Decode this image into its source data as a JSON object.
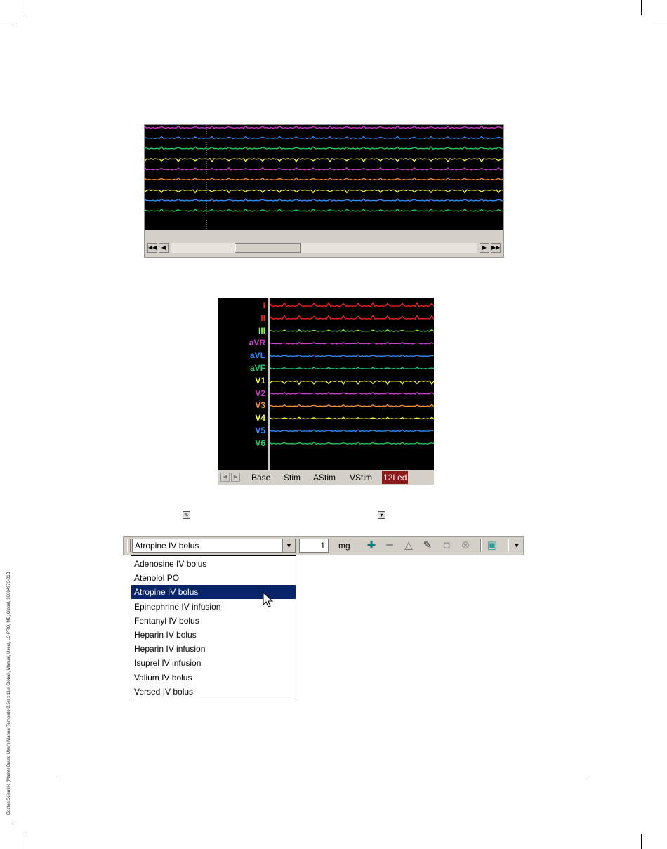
{
  "margin_note": "Boston Scientific (Master Brand User's Manual Template 8.5in x 11in Global), Manual, Users, LS PRO, MB, Global, 90084973-01B",
  "strip_panel": {
    "trace_colors": [
      "#d040d0",
      "#3090ff",
      "#20d060",
      "#ffff40",
      "#d040d0",
      "#ff9030",
      "#ffff40",
      "#3090ff",
      "#20d060"
    ],
    "scroll_buttons": {
      "first": "◀◀",
      "prev": "◀",
      "next": "▶",
      "last": "▶▶"
    }
  },
  "lead_panel": {
    "leads": [
      {
        "name": "I",
        "color": "#ff2020"
      },
      {
        "name": "II",
        "color": "#ff2020"
      },
      {
        "name": "III",
        "color": "#80ff40"
      },
      {
        "name": "aVR",
        "color": "#d040d0"
      },
      {
        "name": "aVL",
        "color": "#3090ff"
      },
      {
        "name": "aVF",
        "color": "#20d080"
      },
      {
        "name": "V1",
        "color": "#ffff40"
      },
      {
        "name": "V2",
        "color": "#d040d0"
      },
      {
        "name": "V3",
        "color": "#ff9030"
      },
      {
        "name": "V4",
        "color": "#ffff40"
      },
      {
        "name": "V5",
        "color": "#3090ff"
      },
      {
        "name": "V6",
        "color": "#20d060"
      }
    ],
    "tabs": [
      "Base",
      "Stim",
      "AStim",
      "VStim",
      "12Led"
    ],
    "active_tab": "12Led",
    "tab_arrows": {
      "left": "◀",
      "right": "▶"
    }
  },
  "inline_icons": {
    "pen": "✎",
    "syringe_pump": "▾"
  },
  "drug_toolbar": {
    "selected_drug": "Atropine IV bolus",
    "dropdown_arrow": "▼",
    "dose_value": "1",
    "dose_unit": "mg",
    "icons": [
      {
        "name": "add-icon",
        "glyph": "✚",
        "color": "#007a7a"
      },
      {
        "name": "remove-icon",
        "glyph": "━",
        "color": "#8a8a8a"
      },
      {
        "name": "triangle-icon",
        "glyph": "△",
        "color": "#707070"
      },
      {
        "name": "syringe-icon",
        "glyph": "✎",
        "color": "#303030"
      },
      {
        "name": "iv-bag-icon",
        "glyph": "◘",
        "color": "#909090"
      },
      {
        "name": "cancel-icon",
        "glyph": "⊗",
        "color": "#909090"
      },
      {
        "name": "bottle-icon",
        "glyph": "▣",
        "color": "#30a0a0"
      }
    ],
    "overflow": "▾"
  },
  "drug_list": {
    "items": [
      "Adenosine IV bolus",
      "Atenolol PO",
      "Atropine IV bolus",
      "Epinephrine IV infusion",
      "Fentanyl IV bolus",
      "Heparin IV bolus",
      "Heparin IV infusion",
      "Isuprel IV infusion",
      "Valium IV bolus",
      "Versed IV bolus"
    ],
    "highlighted_index": 2
  }
}
